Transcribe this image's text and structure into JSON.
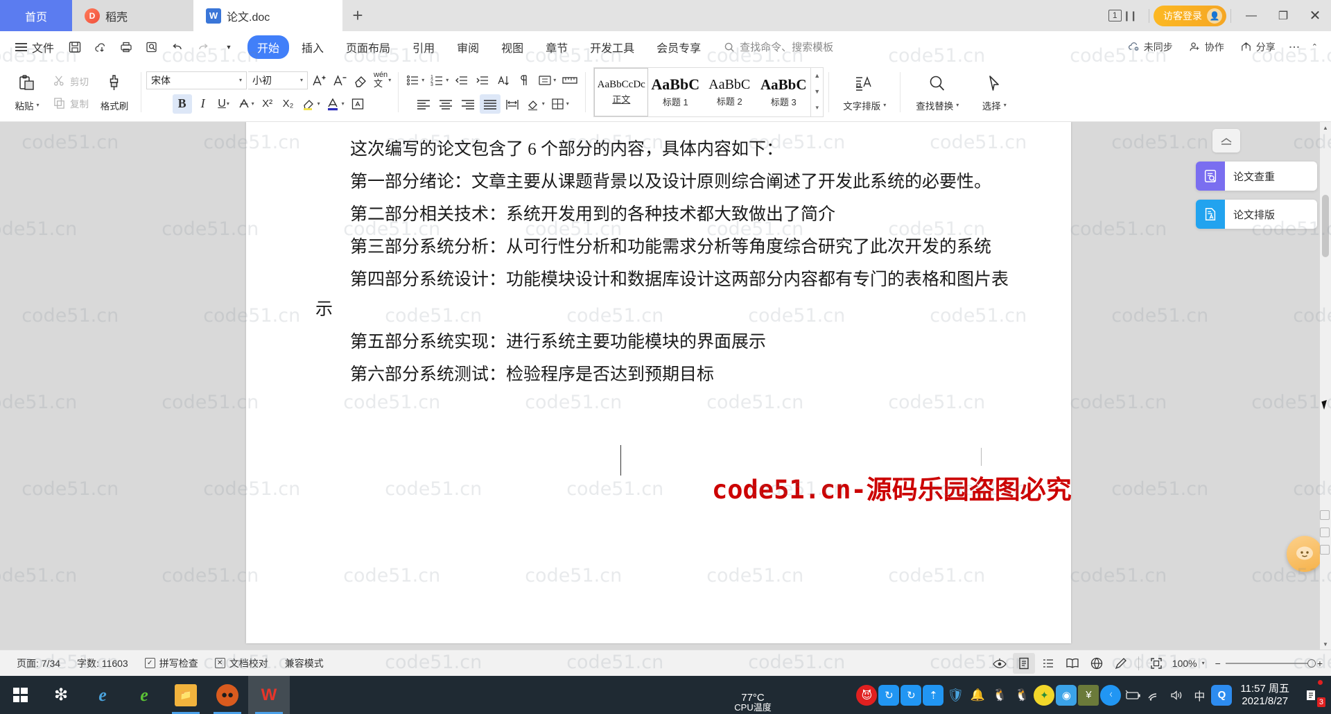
{
  "titlebar": {
    "tabs": [
      {
        "label": "首页",
        "icon": "home-icon"
      },
      {
        "label": "稻壳",
        "icon": "docer-icon"
      },
      {
        "label": "论文.doc",
        "icon": "wps-doc-icon"
      }
    ],
    "new_tab_label": "+",
    "page_count_badge": "1",
    "login_label": "访客登录",
    "minimize": "—",
    "restore": "❐",
    "close": "✕"
  },
  "quick_access": {
    "file_label": "文件",
    "buttons": [
      "save-icon",
      "save-as-cloud-icon",
      "print-icon",
      "print-preview-icon",
      "undo-icon",
      "redo-icon",
      "customize-caret-icon"
    ]
  },
  "ribbon_tabs": [
    {
      "label": "开始",
      "active": true
    },
    {
      "label": "插入",
      "active": false
    },
    {
      "label": "页面布局",
      "active": false
    },
    {
      "label": "引用",
      "active": false
    },
    {
      "label": "审阅",
      "active": false
    },
    {
      "label": "视图",
      "active": false
    },
    {
      "label": "章节",
      "active": false
    },
    {
      "label": "开发工具",
      "active": false
    },
    {
      "label": "会员专享",
      "active": false
    }
  ],
  "search": {
    "placeholder": "查找命令、搜索模板"
  },
  "ribbon_right": [
    {
      "label": "未同步",
      "icon": "cloud-off-icon"
    },
    {
      "label": "协作",
      "icon": "collaborate-icon"
    },
    {
      "label": "分享",
      "icon": "share-icon"
    },
    {
      "label": "",
      "icon": "more-options-icon"
    }
  ],
  "ribbon": {
    "paste_label": "粘贴",
    "cut_label": "剪切",
    "copy_label": "复制",
    "format_painter_label": "格式刷",
    "font_name": "宋体",
    "font_size": "小初",
    "bold_label": "B",
    "italic_label": "I",
    "underline_label": "U",
    "superscript_label": "X²",
    "subscript_label": "X₂",
    "grow_font_label": "A⁺",
    "shrink_font_label": "A⁻",
    "clear_format_label": "clear-format-icon",
    "pinyin_label": "wén",
    "highlight_label": "highlight-icon",
    "font_color_label": "font-color-icon",
    "char_border_label": "A",
    "styles": [
      {
        "preview": "AaBbCcDc",
        "label": "正文",
        "selected": true
      },
      {
        "preview": "AaBbC",
        "label": "标题 1",
        "selected": false
      },
      {
        "preview": "AaBbC",
        "label": "标题 2",
        "selected": false
      },
      {
        "preview": "AaBbC",
        "label": "标题 3",
        "selected": false
      }
    ],
    "typography_label": "文字排版",
    "find_replace_label": "查找替换",
    "select_label": "选择"
  },
  "document": {
    "paragraphs": [
      "这次编写的论文包含了 6 个部分的内容，具体内容如下：",
      "第一部分绪论：文章主要从课题背景以及设计原则综合阐述了开发此系统的必要性。",
      "第二部分相关技术：系统开发用到的各种技术都大致做出了简介",
      "第三部分系统分析：从可行性分析和功能需求分析等角度综合研究了此次开发的系统",
      "第四部分系统设计：功能模块设计和数据库设计这两部分内容都有专门的表格和图片表示",
      "第五部分系统实现：进行系统主要功能模块的界面展示",
      "第六部分系统测试：检验程序是否达到预期目标"
    ],
    "red_watermark": "code51.cn-源码乐园盗图必究"
  },
  "float_panel": {
    "collapse_icon": "collapse-panel-icon",
    "items": [
      {
        "label": "论文查重",
        "icon": "paper-check-icon",
        "color": "#7a6ef0"
      },
      {
        "label": "论文排版",
        "icon": "paper-format-icon",
        "color": "#22a3ef"
      }
    ]
  },
  "statusbar": {
    "page_label": "页面: 7/34",
    "words_label": "字数: 11603",
    "spellcheck_label": "拼写检查",
    "proofread_label": "文档校对",
    "compat_label": "兼容模式",
    "view_icons": [
      "eye-icon",
      "print-layout-icon",
      "outline-view-icon",
      "read-layout-icon",
      "web-layout-icon",
      "pen-icon",
      "fullscreen-icon"
    ],
    "zoom_label": "100%",
    "zoom_out": "−",
    "zoom_in": "+"
  },
  "taskbar": {
    "start_icon": "windows-start-icon",
    "apps": [
      {
        "name": "pinwheel-app-icon",
        "glyph": "✿",
        "bg": "#1f2a33",
        "fg": "#ffffff"
      },
      {
        "name": "internet-explorer-icon",
        "glyph": "e",
        "bg": "#1f2a33",
        "fg": "#4aa3dd"
      },
      {
        "name": "360-browser-icon",
        "glyph": "e",
        "bg": "#1f2a33",
        "fg": "#5bc236"
      },
      {
        "name": "file-explorer-icon",
        "glyph": "🗀",
        "bg": "#1f2a33",
        "fg": "#f2b33d"
      },
      {
        "name": "raccoon-app-icon",
        "glyph": "◕",
        "bg": "#d95b1e",
        "fg": "#2b2b2b"
      },
      {
        "name": "wps-office-icon",
        "glyph": "W",
        "bg": "#1f2a33",
        "fg": "#e8352a"
      }
    ],
    "cpu_temp_value": "77°C",
    "cpu_temp_label": "CPU温度",
    "tray_icons": [
      {
        "name": "red-mask-tray-icon",
        "glyph": "●",
        "bg": "#e02020"
      },
      {
        "name": "sync-tray-icon-1",
        "glyph": "↻",
        "bg": "#2196f3"
      },
      {
        "name": "sync-tray-icon-2",
        "glyph": "↻",
        "bg": "#2196f3"
      },
      {
        "name": "upload-tray-icon",
        "glyph": "↥",
        "bg": "#2196f3"
      },
      {
        "name": "tencent-security-icon",
        "glyph": "🛡",
        "bg": "#1f2a33"
      },
      {
        "name": "bell-tray-icon",
        "glyph": "🔔",
        "bg": "#1f2a33"
      },
      {
        "name": "qq-tray-icon-1",
        "glyph": "🐧",
        "bg": "#1f2a33"
      },
      {
        "name": "qq-tray-icon-2",
        "glyph": "🐧",
        "bg": "#1f2a33"
      },
      {
        "name": "qq-music-icon",
        "glyph": "✦",
        "bg": "#f2d72a"
      },
      {
        "name": "netdisk-icon",
        "glyph": "◎",
        "bg": "#3ba3e8"
      },
      {
        "name": "money-tray-icon",
        "glyph": "¥",
        "bg": "#6b7a3a"
      },
      {
        "name": "bluetooth-icon",
        "glyph": "ᛒ",
        "bg": "#2196f3"
      }
    ],
    "sym_icons": [
      "battery-icon",
      "wifi-icon",
      "volume-icon",
      "ime-chinese-icon",
      "qq-browser-icon"
    ],
    "ime_label": "中",
    "qq_browser_label": "Q",
    "clock_time": "11:57 周五",
    "clock_date": "2021/8/27",
    "notification_count": "3"
  },
  "watermark": {
    "text": "code51.cn"
  }
}
